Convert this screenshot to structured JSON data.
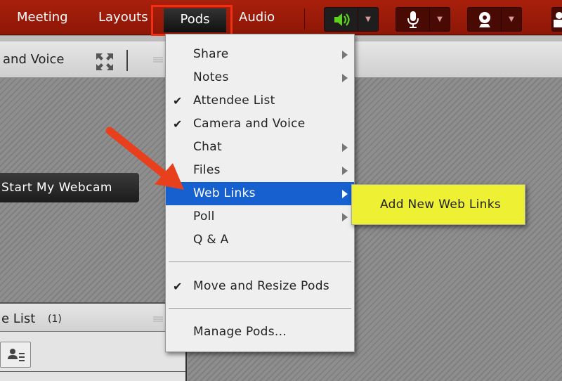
{
  "menubar": {
    "items": [
      "Meeting",
      "Layouts",
      "Pods",
      "Audio"
    ]
  },
  "toolbar": {
    "speaker_color": "#5fd21e",
    "buttons": [
      "speaker-icon",
      "microphone-icon",
      "webcam-icon",
      "person-icon"
    ]
  },
  "camera_pod": {
    "title": "and Voice",
    "start_webcam": "Start My Webcam"
  },
  "attendee_pod": {
    "title": "e List",
    "count": "(1)"
  },
  "pods_menu": {
    "items": [
      {
        "label": "Share",
        "checked": false,
        "submenu": true
      },
      {
        "label": "Notes",
        "checked": false,
        "submenu": true
      },
      {
        "label": "Attendee List",
        "checked": true,
        "submenu": false
      },
      {
        "label": "Camera and Voice",
        "checked": true,
        "submenu": false
      },
      {
        "label": "Chat",
        "checked": false,
        "submenu": true
      },
      {
        "label": "Files",
        "checked": false,
        "submenu": true
      },
      {
        "label": "Web Links",
        "checked": false,
        "submenu": true,
        "highlighted": true
      },
      {
        "label": "Poll",
        "checked": false,
        "submenu": true
      },
      {
        "label": "Q & A",
        "checked": false,
        "submenu": false
      },
      {
        "label": "Move and Resize Pods",
        "checked": true,
        "submenu": false
      },
      {
        "label": "Manage Pods...",
        "checked": false,
        "submenu": false
      }
    ],
    "check_glyph": "✔"
  },
  "submenu": {
    "item": "Add New Web Links",
    "color": "#eef034"
  },
  "colors": {
    "topbar": "#9a1a0a",
    "highlight": "#1660d0",
    "annotation": "#f03010"
  }
}
